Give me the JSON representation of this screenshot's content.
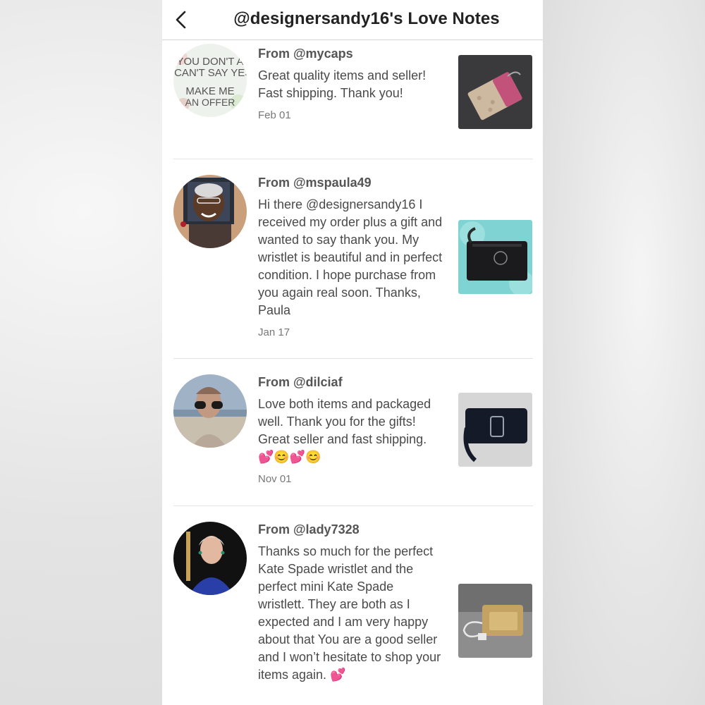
{
  "header": {
    "title": "@designersandy16's Love Notes",
    "back_icon": "chevron-left-icon"
  },
  "notes": [
    {
      "from": "From @mycaps",
      "message": "Great quality items and seller! Fast shipping. Thank you!",
      "date": "Feb 01",
      "avatar_text_top": "YOU DON'T A I CAN'T SAY YES",
      "avatar_text_bottom": "MAKE ME AN OFFER"
    },
    {
      "from": "From @mspaula49",
      "message": "Hi there @designersandy16 I received my order plus a gift and wanted to say thank you. My wristlet is beautiful and in perfect condition. I hope purchase from you again real soon. Thanks, Paula",
      "date": "Jan 17"
    },
    {
      "from": "From @dilciaf",
      "message": "Love both items and packaged well. Thank you for the gifts! Great seller and fast shipping. 💕😊💕😊",
      "date": "Nov 01"
    },
    {
      "from": "From @lady7328",
      "message": "Thanks so much for the perfect Kate Spade wristlet and the perfect mini Kate Spade wristlett. They are both as I expected and I am very happy about that You are a good seller and I won’t hesitate to shop your items again. 💕"
    }
  ],
  "colors": {
    "text_primary": "#222222",
    "text_from": "#555555",
    "text_message": "#4a4a4a",
    "text_date": "#777777",
    "divider": "#e4e4e4"
  }
}
